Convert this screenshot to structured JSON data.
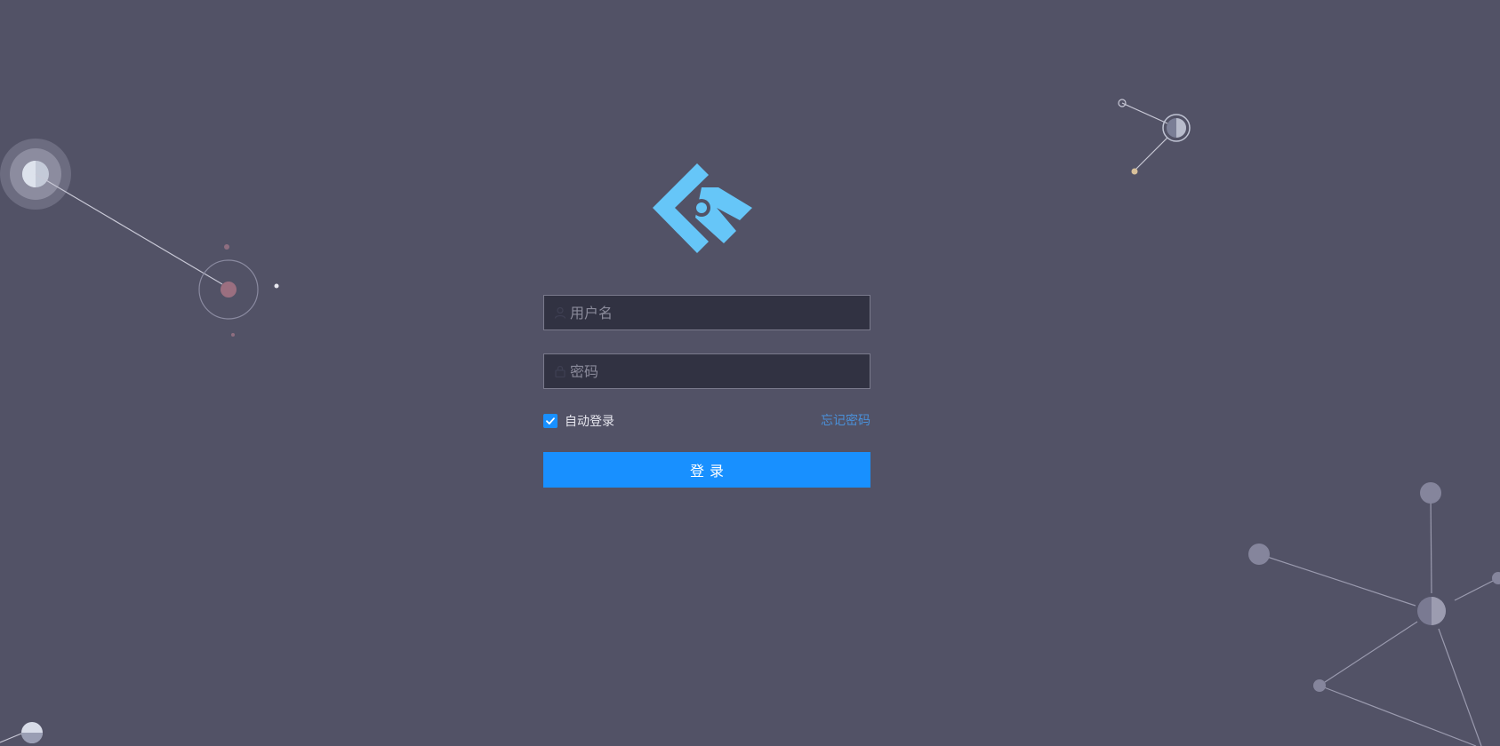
{
  "login": {
    "username_placeholder": "用户名",
    "password_placeholder": "密码",
    "remember_label": "自动登录",
    "remember_checked": true,
    "forgot_label": "忘记密码",
    "submit_label": "登录"
  },
  "icons": {
    "logo": "brand-logo",
    "username": "user-icon",
    "password": "lock-icon",
    "remember": "check-icon"
  },
  "colors": {
    "background": "#525266",
    "input_background": "#313242",
    "accent": "#1890ff",
    "link": "#4a90d9",
    "logo": "#66c6f8"
  }
}
